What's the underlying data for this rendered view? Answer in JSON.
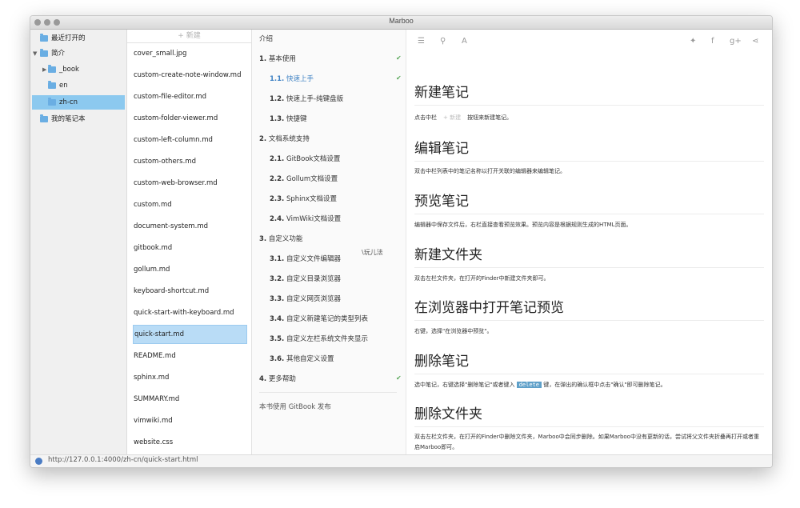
{
  "window": {
    "title": "Marboo"
  },
  "sidebar": {
    "items": [
      {
        "label": "最近打开的"
      },
      {
        "label": "简介"
      },
      {
        "label": "_book"
      },
      {
        "label": "en"
      },
      {
        "label": "zh-cn"
      },
      {
        "label": "我的笔记本"
      }
    ]
  },
  "filelist": {
    "new_label": "+  新建",
    "files": [
      "cover_small.jpg",
      "custom-create-note-window.md",
      "custom-file-editor.md",
      "custom-folder-viewer.md",
      "custom-left-column.md",
      "custom-others.md",
      "custom-web-browser.md",
      "custom.md",
      "document-system.md",
      "gitbook.md",
      "gollum.md",
      "keyboard-shortcut.md",
      "quick-start-with-keyboard.md",
      "quick-start.md",
      "README.md",
      "sphinx.md",
      "SUMMARY.md",
      "vimwiki.md",
      "website.css"
    ]
  },
  "toc": {
    "intro": "介绍",
    "items": [
      {
        "num": "1.",
        "label": "基本使用"
      },
      {
        "num": "1.1.",
        "label": "快速上手"
      },
      {
        "num": "1.2.",
        "label": "快速上手-纯键盘版"
      },
      {
        "num": "1.3.",
        "label": "快捷键"
      },
      {
        "num": "2.",
        "label": "文档系统支持"
      },
      {
        "num": "2.1.",
        "label": "GitBook文档设置"
      },
      {
        "num": "2.2.",
        "label": "Gollum文档设置"
      },
      {
        "num": "2.3.",
        "label": "Sphinx文档设置"
      },
      {
        "num": "2.4.",
        "label": "VimWiki文档设置"
      },
      {
        "num": "3.",
        "label": "自定义功能"
      },
      {
        "num": "3.1.",
        "label": "自定义文件编辑器"
      },
      {
        "num": "3.2.",
        "label": "自定义目录浏览器"
      },
      {
        "num": "3.3.",
        "label": "自定义网页浏览器"
      },
      {
        "num": "3.4.",
        "label": "自定义新建笔记的类型列表"
      },
      {
        "num": "3.5.",
        "label": "自定义左栏系统文件夹显示"
      },
      {
        "num": "3.6.",
        "label": "其他自定义设置"
      },
      {
        "num": "4.",
        "label": "更多帮助"
      }
    ],
    "footer": "本书使用 GitBook 发布"
  },
  "content": {
    "sections": [
      {
        "heading": "新建笔记",
        "text_a": "点击中栏",
        "btn": "+  新建",
        "text_b": "按钮来新建笔记。"
      },
      {
        "heading": "编辑笔记",
        "text": "双击中栏列表中的笔记名称以打开关联的编辑器来编辑笔记。"
      },
      {
        "heading": "预览笔记",
        "text": "编辑器中保存文件后，右栏直接查看预览效果。预览内容是根据规则生成的HTML页面。"
      },
      {
        "heading": "新建文件夹",
        "text": "双击左栏文件夹，在打开的Finder中新建文件夹即可。"
      },
      {
        "heading": "在浏览器中打开笔记预览",
        "text": "右键，选择\"在浏览器中预览\"。"
      },
      {
        "heading": "删除笔记",
        "text_a": "选中笔记，右键选择\"删除笔记\"或者键入",
        "code": "delete",
        "text_b": "键，在弹出的确认框中点击\"确认\"即可删除笔记。"
      },
      {
        "heading": "删除文件夹",
        "text": "双击左栏文件夹，在打开的Finder中删除文件夹，Marboo中会同步删除。如果Marboo中没有更新的话，尝试将父文件夹折叠再打开或者重启Marboo即可。"
      }
    ]
  },
  "statusbar": {
    "url": "http://127.0.0.1:4000/zh-cn/quick-start.html"
  },
  "watermark": "\\玩儿法",
  "icons": {
    "toolbar_left": [
      "menu-icon",
      "search-icon",
      "font-icon"
    ],
    "toolbar_right": [
      "twitter-icon",
      "facebook-icon",
      "google-plus-icon",
      "share-icon"
    ]
  }
}
